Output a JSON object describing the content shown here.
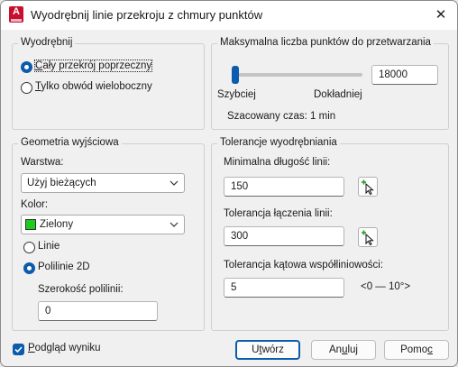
{
  "window": {
    "title": "Wyodrębnij linie przekroju z chmury punktów",
    "icon_letter": "A"
  },
  "extract_group": {
    "title": "Wyodrębnij",
    "options": [
      {
        "label_pre": "",
        "label_mn": "C",
        "label_post": "ały przekrój poprzeczny",
        "checked": true
      },
      {
        "label_pre": "",
        "label_mn": "T",
        "label_post": "ylko obwód wieloboczny",
        "checked": false
      }
    ]
  },
  "max_points_group": {
    "title": "Maksymalna liczba punktów do przetwarzania",
    "slider_fraction": 0.0,
    "value": "18000",
    "label_fast": "Szybciej",
    "label_accurate": "Dokładniej",
    "estimated_time": "Szacowany czas: 1 min"
  },
  "output_group": {
    "title": "Geometria wyjściowa",
    "layer_label": "Warstwa:",
    "layer_value": "Użyj bieżących",
    "color_label": "Kolor:",
    "color_value": "Zielony",
    "color_hex": "#1dcc1d",
    "lines_label": "Linie",
    "polylines_label": "Polilinie 2D",
    "polyline_width_label": "Szerokość polilinii:",
    "polyline_width_value": "0"
  },
  "tolerance_group": {
    "title": "Tolerancje wyodrębniania",
    "min_length_label": "Minimalna długość linii:",
    "min_length_value": "150",
    "join_label": "Tolerancja łączenia linii:",
    "join_value": "300",
    "angle_label": "Tolerancja kątowa współliniowości:",
    "angle_value": "5",
    "angle_range": "<0 — 10°>"
  },
  "footer": {
    "preview_pre": "",
    "preview_mn": "P",
    "preview_post": "odgląd wyniku",
    "preview_checked": true,
    "create_pre": "U",
    "create_mn": "t",
    "create_post": "wórz",
    "cancel_pre": "An",
    "cancel_mn": "u",
    "cancel_post": "luj",
    "help_pre": "Pomo",
    "help_mn": "c",
    "help_post": ""
  }
}
